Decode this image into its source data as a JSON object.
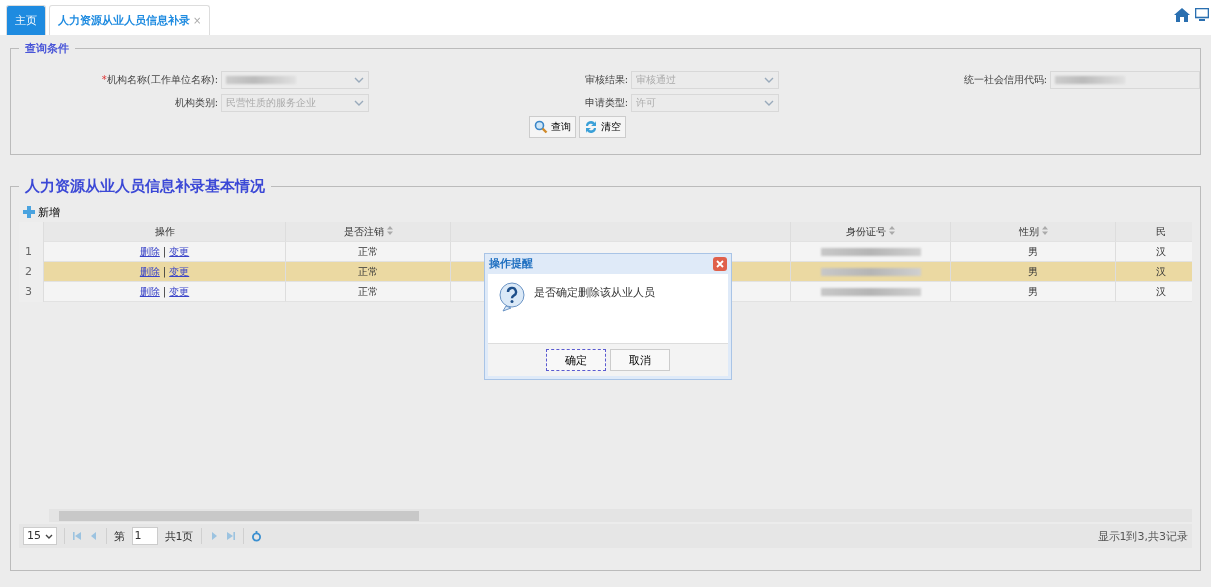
{
  "tabs": [
    {
      "label": "主页",
      "selected": false
    },
    {
      "label": "人力资源从业人员信息补录",
      "selected": true
    }
  ],
  "close_mark": "×",
  "query": {
    "title": "查询条件",
    "fields": [
      {
        "label": "机构名称(工作单位名称):",
        "required_mark": "*",
        "kind": "select",
        "redacted": true
      },
      {
        "label": "审核结果:",
        "kind": "select",
        "value": "审核通过"
      },
      {
        "label": "统一社会信用代码:",
        "kind": "input",
        "redacted": true
      },
      {
        "label": "机构类别:",
        "kind": "select",
        "value": "民营性质的服务企业"
      },
      {
        "label": "申请类型:",
        "kind": "select",
        "value": "许可"
      }
    ],
    "buttons": [
      {
        "label": "查询",
        "kind": "search"
      },
      {
        "label": "清空",
        "kind": "clear"
      }
    ]
  },
  "grid": {
    "title": "人力资源从业人员信息补录基本情况",
    "add_button": "新增",
    "columns": [
      {
        "label": "操作",
        "sortable": false
      },
      {
        "label": "是否注销",
        "sortable": true
      },
      {
        "label": "身份证号",
        "sortable": true
      },
      {
        "label": "性别",
        "sortable": true
      },
      {
        "label": "民",
        "sortable": false
      }
    ],
    "rows": [
      {
        "number": "1",
        "selected": false,
        "delete": "删除",
        "separator": "|",
        "change": "变更",
        "status": "正常",
        "gender": "男",
        "ethnicity": "汉"
      },
      {
        "number": "2",
        "selected": true,
        "delete": "删除",
        "separator": "|",
        "change": "变更",
        "status": "正常",
        "gender": "男",
        "ethnicity": "汉"
      },
      {
        "number": "3",
        "selected": false,
        "delete": "删除",
        "separator": "|",
        "change": "变更",
        "status": "正常",
        "gender": "男",
        "ethnicity": "汉"
      }
    ],
    "pager": {
      "page_size": "15",
      "page_prefix": "第",
      "page": "1",
      "page_suffix": "共1页",
      "summary": "显示1到3,共3记录"
    }
  },
  "dialog": {
    "title": "操作提醒",
    "message": "是否确定删除该从业人员",
    "buttons": [
      {
        "label": "确定",
        "selected": true
      },
      {
        "label": "取消",
        "selected": false
      }
    ]
  }
}
